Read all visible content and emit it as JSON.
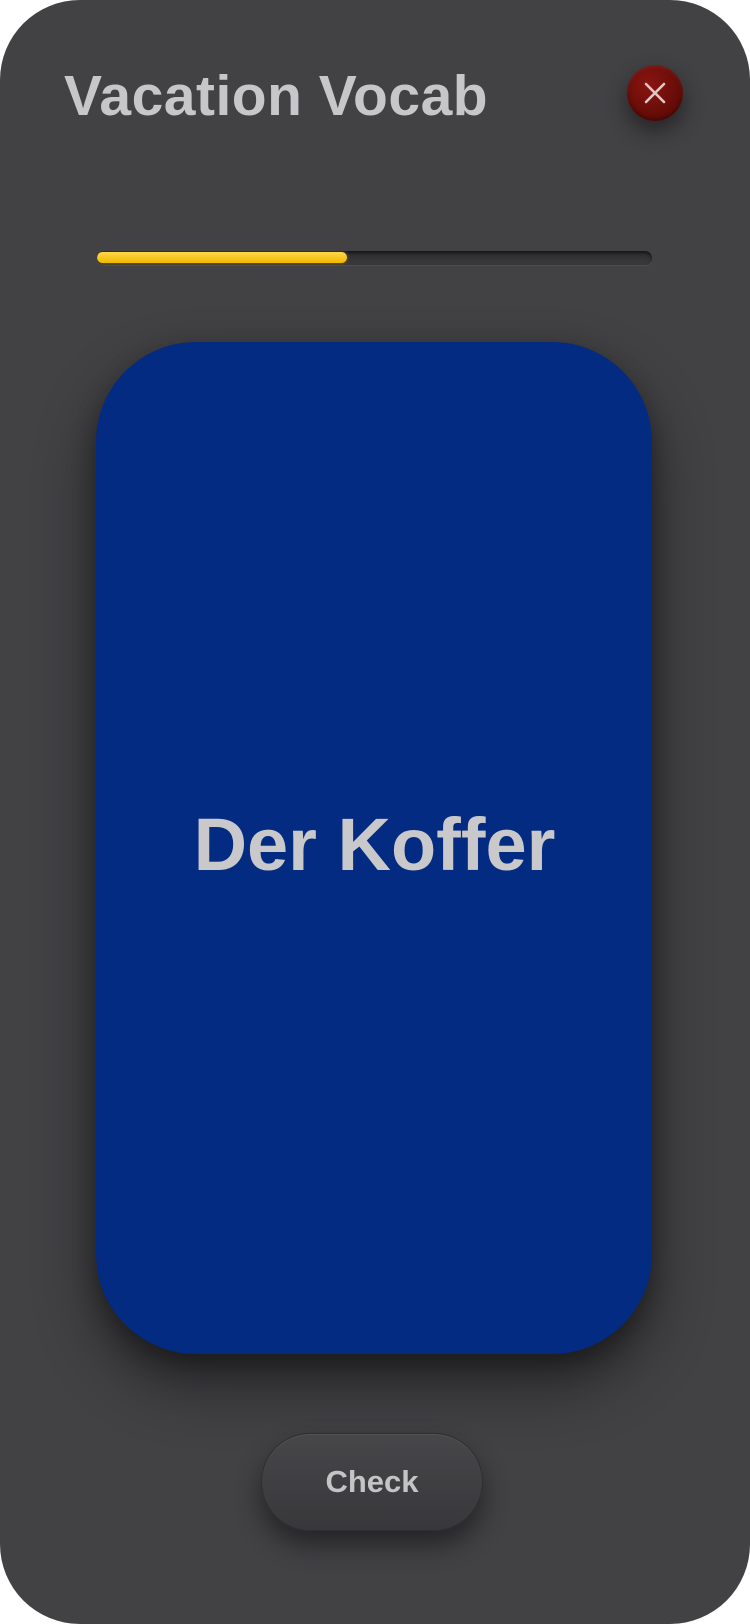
{
  "header": {
    "title": "Vacation Vocab",
    "close_icon": "close-icon"
  },
  "progress": {
    "fraction": 0.45,
    "color": "#f5c400"
  },
  "flashcard": {
    "word": "Der Koffer",
    "color": "#032b82"
  },
  "actions": {
    "check_label": "Check"
  },
  "colors": {
    "background": "#424144",
    "close_button": "#6a0d09",
    "text": "#c7c7c9"
  }
}
